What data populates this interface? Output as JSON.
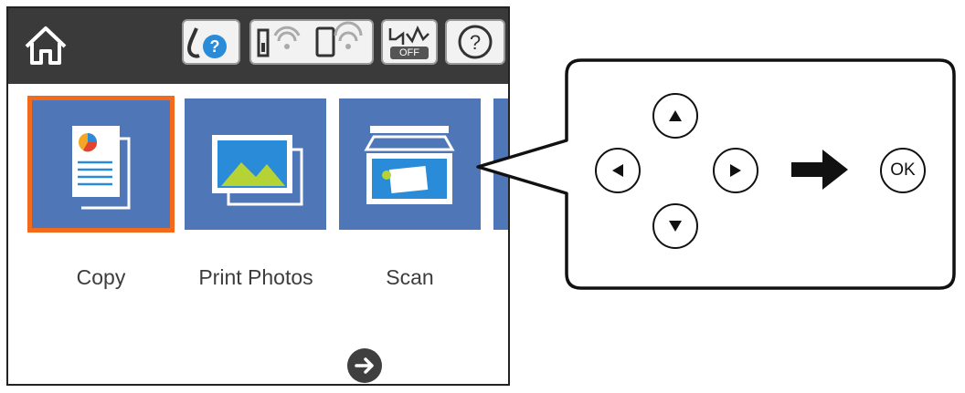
{
  "tiles": [
    {
      "label": "Copy"
    },
    {
      "label": "Print Photos"
    },
    {
      "label": "Scan"
    }
  ],
  "status_icons": {
    "wifi_direct_off_label": "OFF"
  },
  "callout": {
    "ok_label": "OK"
  },
  "colors": {
    "topbar": "#3a3a3a",
    "tile": "#4f77b8",
    "selection": "#f26b1d"
  }
}
